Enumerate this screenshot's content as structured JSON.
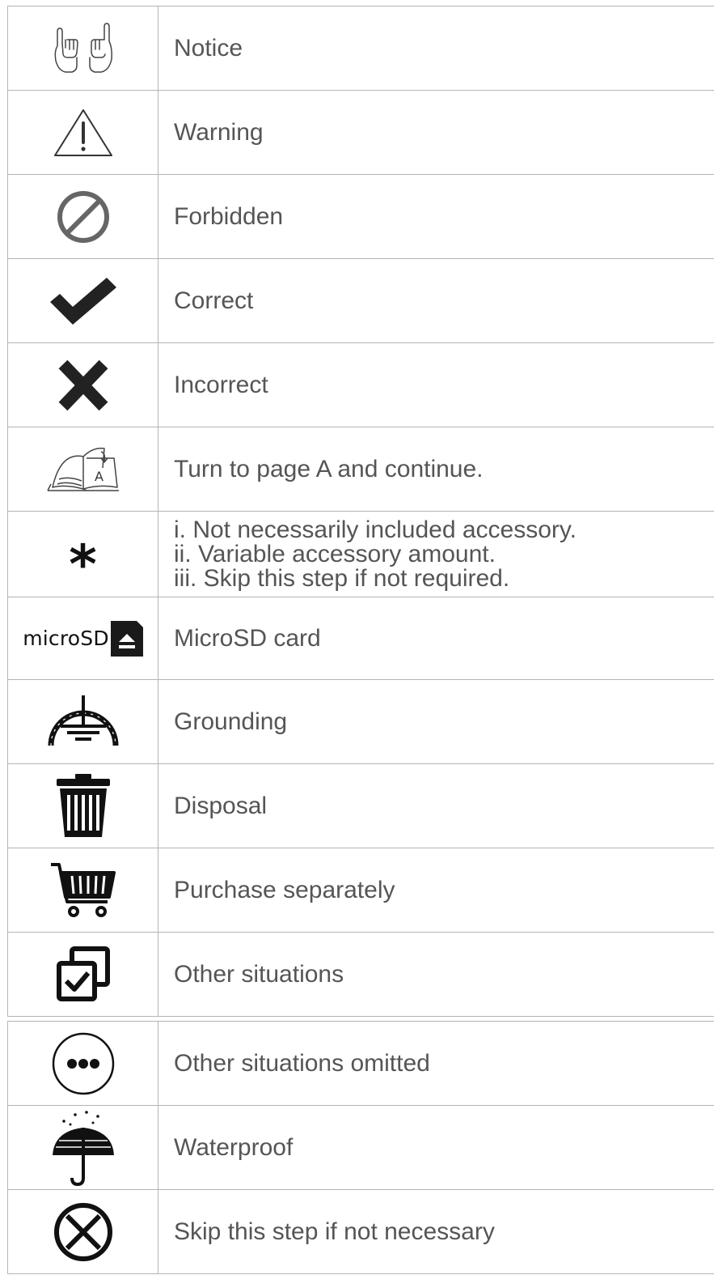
{
  "rows": [
    {
      "icon": "notice-hands-icon",
      "label": "Notice"
    },
    {
      "icon": "warning-icon",
      "label": "Warning"
    },
    {
      "icon": "forbidden-icon",
      "label": "Forbidden"
    },
    {
      "icon": "checkmark-icon",
      "label": "Correct"
    },
    {
      "icon": "cross-icon",
      "label": "Incorrect"
    },
    {
      "icon": "open-book-icon",
      "icon_letter": "A",
      "label": "Turn to page A and continue."
    },
    {
      "icon": "asterisk-icon",
      "icon_glyph": "*",
      "lines": [
        "i. Not necessarily included accessory.",
        "ii. Variable accessory amount.",
        "iii. Skip this step if not required."
      ]
    },
    {
      "icon": "microsd-icon",
      "icon_text": "microSD",
      "label": "MicroSD card"
    },
    {
      "icon": "grounding-icon",
      "label": "Grounding"
    },
    {
      "icon": "trash-can-icon",
      "label": "Disposal"
    },
    {
      "icon": "shopping-cart-icon",
      "label": "Purchase separately"
    },
    {
      "icon": "checked-boxes-icon",
      "label": "Other situations"
    }
  ],
  "rows2": [
    {
      "icon": "ellipsis-circle-icon",
      "label": "Other situations omitted"
    },
    {
      "icon": "umbrella-icon",
      "label": "Waterproof"
    },
    {
      "icon": "circle-x-icon",
      "label": "Skip this step if not necessary"
    }
  ]
}
